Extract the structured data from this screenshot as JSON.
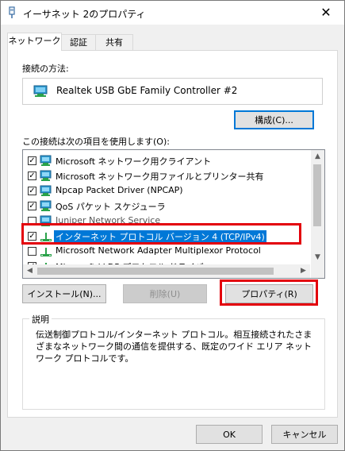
{
  "window": {
    "title": "イーサネット 2のプロパティ",
    "close_glyph": "✕"
  },
  "tabs": [
    {
      "label": "ネットワーク"
    },
    {
      "label": "認証"
    },
    {
      "label": "共有"
    }
  ],
  "connect_using": {
    "label": "接続の方法:",
    "adapter": "Realtek USB GbE Family Controller #2",
    "configure_button": "構成(C)..."
  },
  "items_section": {
    "label": "この接続は次の項目を使用します(O):",
    "items": [
      {
        "checked": true,
        "icon": "network-client-icon",
        "label": "Microsoft ネットワーク用クライアント"
      },
      {
        "checked": true,
        "icon": "network-client-icon",
        "label": "Microsoft ネットワーク用ファイルとプリンター共有"
      },
      {
        "checked": true,
        "icon": "network-client-icon",
        "label": "Npcap Packet Driver (NPCAP)"
      },
      {
        "checked": true,
        "icon": "network-client-icon",
        "label": "QoS パケット スケジューラ"
      },
      {
        "checked": false,
        "icon": "network-client-icon",
        "label": "Juniper Network Service"
      },
      {
        "checked": true,
        "icon": "protocol-icon",
        "label": "インターネット プロトコル バージョン 4 (TCP/IPv4)",
        "selected": true
      },
      {
        "checked": false,
        "icon": "protocol-icon",
        "label": "Microsoft Network Adapter Multiplexor Protocol"
      },
      {
        "checked": true,
        "icon": "protocol-icon",
        "label": "Microsoft LLDP プロトコル ドライバー"
      }
    ]
  },
  "buttons": {
    "install": "インストール(N)...",
    "uninstall": "削除(U)",
    "properties": "プロパティ(R)"
  },
  "description": {
    "label": "説明",
    "text": "伝送制御プロトコル/インターネット プロトコル。相互接続されたさまざまなネットワーク間の通信を提供する、既定のワイド エリア ネットワーク プロトコルです。"
  },
  "dialog_buttons": {
    "ok": "OK",
    "cancel": "キャンセル"
  },
  "colors": {
    "accent": "#0078d7",
    "highlight_box": "#e3000b"
  }
}
